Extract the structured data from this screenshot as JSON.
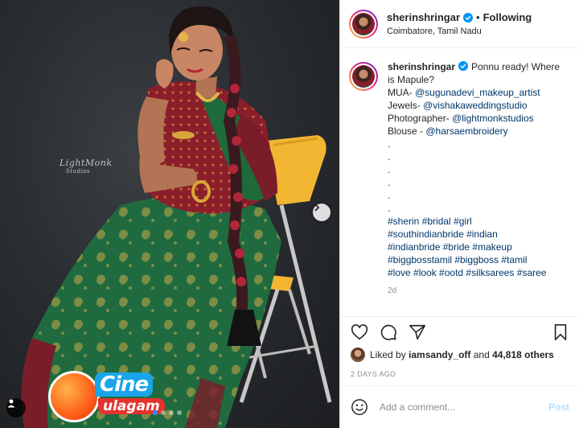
{
  "post": {
    "username": "sherinshringar",
    "verified": true,
    "follow_separator": "•",
    "follow_status": "Following",
    "location": "Coimbatore, Tamil Nadu",
    "caption": {
      "username": "sherinshringar",
      "lines": [
        {
          "text": "Ponnu ready! Where",
          "type": "first"
        },
        {
          "text": "is Mapule?",
          "type": "text"
        },
        {
          "prefix": "MUA- ",
          "link": "@sugunadevi_makeup_artist"
        },
        {
          "prefix": "Jewels- ",
          "link": "@vishakaweddingstudio"
        },
        {
          "prefix": "Photographer- ",
          "link": "@lightmonkstudios"
        },
        {
          "prefix": "Blouse - ",
          "link": "@harsaembroidery"
        },
        {
          "text": "."
        },
        {
          "text": "."
        },
        {
          "text": "."
        },
        {
          "text": "."
        },
        {
          "text": "."
        },
        {
          "text": "."
        },
        {
          "link": "#sherin #bridal #girl"
        },
        {
          "link": "#southindianbride #indian"
        },
        {
          "link": "#indianbride #bride #makeup"
        },
        {
          "link": "#biggbosstamil #biggboss #tamil"
        },
        {
          "link": "#love #look #ootd #silksarees #saree"
        }
      ],
      "age": "2d"
    },
    "likes": {
      "prefix": "Liked by",
      "user": "iamsandy_off",
      "middle": "and",
      "count": "44,818 others"
    },
    "date": "2 DAYS AGO",
    "comment": {
      "placeholder": "Add a comment...",
      "post_label": "Post"
    }
  },
  "media": {
    "watermark": "LightMonk",
    "watermark_sub": "Studios",
    "carousel_dots": 4,
    "active_dot": 1,
    "overlay_logo": {
      "line1": "Cine",
      "line2": "ulagam"
    }
  },
  "colors": {
    "link": "#00376b",
    "verified": "#0095f6",
    "post_disabled": "#b2dffc",
    "saree_green": "#1f6b3f",
    "blouse_maroon": "#8b1e2b",
    "chair_orange": "#f2b632"
  }
}
